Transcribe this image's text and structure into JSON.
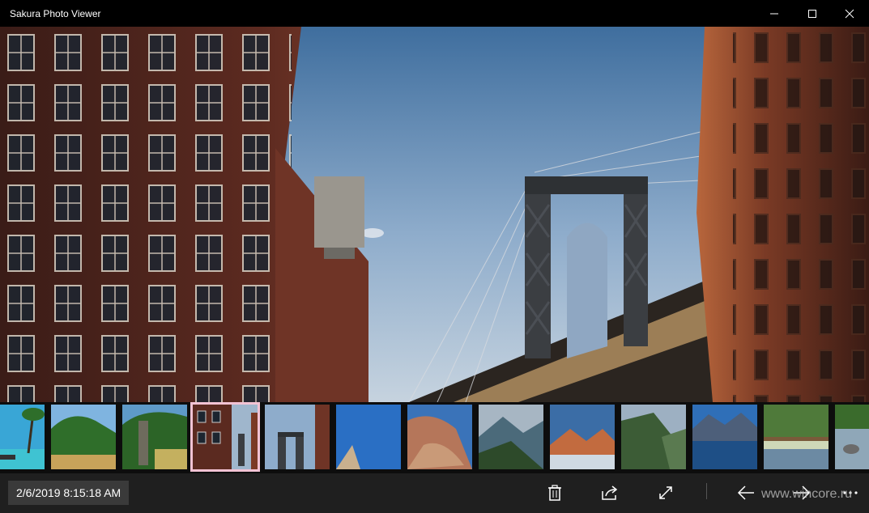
{
  "app": {
    "title": "Sakura Photo Viewer"
  },
  "photo": {
    "timestamp": "2/6/2019 8:15:18 AM"
  },
  "thumbnails": [
    {
      "name": "beach-palm",
      "selected": false
    },
    {
      "name": "green-cliff-coast",
      "selected": false
    },
    {
      "name": "waterfall-cliff",
      "selected": false
    },
    {
      "name": "brick-buildings-bridge",
      "selected": true
    },
    {
      "name": "bridge-tower",
      "selected": false
    },
    {
      "name": "blue-sky",
      "selected": false
    },
    {
      "name": "desert-rock",
      "selected": false
    },
    {
      "name": "mountain-valley",
      "selected": false
    },
    {
      "name": "sunset-mountains",
      "selected": false
    },
    {
      "name": "green-slopes",
      "selected": false
    },
    {
      "name": "alpine-lake",
      "selected": false
    },
    {
      "name": "footbridge-trees",
      "selected": false
    },
    {
      "name": "river-rocks",
      "selected": false
    }
  ],
  "toolbar": {
    "icons": [
      "trash-icon",
      "share-icon",
      "fullscreen-icon",
      "arrow-left-icon",
      "arrow-right-icon",
      "more-icon"
    ]
  },
  "watermark": {
    "text": "www.wincore.ru"
  }
}
